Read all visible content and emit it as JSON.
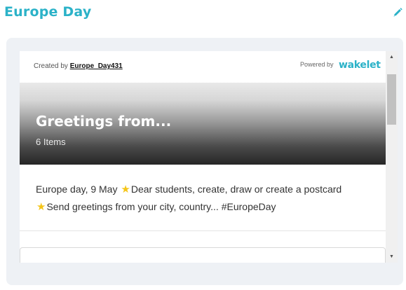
{
  "header": {
    "title": "Europe Day",
    "edit_icon": "pencil-icon"
  },
  "embed": {
    "created_by_label": "Created by",
    "author": "Europe_Day431",
    "powered_by_label": "Powered by",
    "brand": "wakelet",
    "brand_color": "#2bb2c8"
  },
  "collection": {
    "title": "Greetings from...",
    "item_count": "6 Items",
    "description_parts": [
      "Europe day, 9 May ",
      "Dear students, create, draw or create a postcard ",
      "Send greetings from your city, country... #EuropeDay"
    ],
    "star_icon": "star-icon",
    "star_glyph": "★"
  },
  "scrollbar": {
    "up_glyph": "▲",
    "down_glyph": "▼"
  }
}
